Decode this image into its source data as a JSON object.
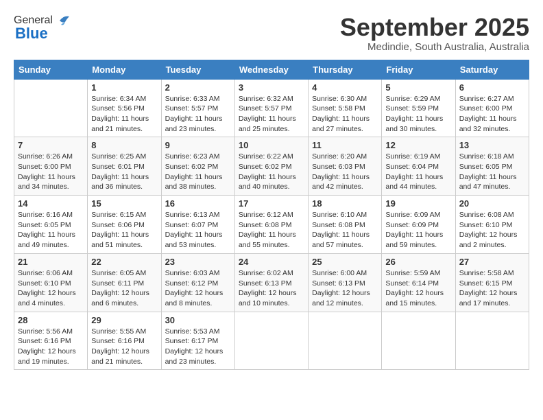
{
  "header": {
    "logo_general": "General",
    "logo_blue": "Blue",
    "month_title": "September 2025",
    "location": "Medindie, South Australia, Australia"
  },
  "calendar": {
    "days_of_week": [
      "Sunday",
      "Monday",
      "Tuesday",
      "Wednesday",
      "Thursday",
      "Friday",
      "Saturday"
    ],
    "weeks": [
      [
        {
          "day": "",
          "text": ""
        },
        {
          "day": "1",
          "text": "Sunrise: 6:34 AM\nSunset: 5:56 PM\nDaylight: 11 hours\nand 21 minutes."
        },
        {
          "day": "2",
          "text": "Sunrise: 6:33 AM\nSunset: 5:57 PM\nDaylight: 11 hours\nand 23 minutes."
        },
        {
          "day": "3",
          "text": "Sunrise: 6:32 AM\nSunset: 5:57 PM\nDaylight: 11 hours\nand 25 minutes."
        },
        {
          "day": "4",
          "text": "Sunrise: 6:30 AM\nSunset: 5:58 PM\nDaylight: 11 hours\nand 27 minutes."
        },
        {
          "day": "5",
          "text": "Sunrise: 6:29 AM\nSunset: 5:59 PM\nDaylight: 11 hours\nand 30 minutes."
        },
        {
          "day": "6",
          "text": "Sunrise: 6:27 AM\nSunset: 6:00 PM\nDaylight: 11 hours\nand 32 minutes."
        }
      ],
      [
        {
          "day": "7",
          "text": "Sunrise: 6:26 AM\nSunset: 6:00 PM\nDaylight: 11 hours\nand 34 minutes."
        },
        {
          "day": "8",
          "text": "Sunrise: 6:25 AM\nSunset: 6:01 PM\nDaylight: 11 hours\nand 36 minutes."
        },
        {
          "day": "9",
          "text": "Sunrise: 6:23 AM\nSunset: 6:02 PM\nDaylight: 11 hours\nand 38 minutes."
        },
        {
          "day": "10",
          "text": "Sunrise: 6:22 AM\nSunset: 6:02 PM\nDaylight: 11 hours\nand 40 minutes."
        },
        {
          "day": "11",
          "text": "Sunrise: 6:20 AM\nSunset: 6:03 PM\nDaylight: 11 hours\nand 42 minutes."
        },
        {
          "day": "12",
          "text": "Sunrise: 6:19 AM\nSunset: 6:04 PM\nDaylight: 11 hours\nand 44 minutes."
        },
        {
          "day": "13",
          "text": "Sunrise: 6:18 AM\nSunset: 6:05 PM\nDaylight: 11 hours\nand 47 minutes."
        }
      ],
      [
        {
          "day": "14",
          "text": "Sunrise: 6:16 AM\nSunset: 6:05 PM\nDaylight: 11 hours\nand 49 minutes."
        },
        {
          "day": "15",
          "text": "Sunrise: 6:15 AM\nSunset: 6:06 PM\nDaylight: 11 hours\nand 51 minutes."
        },
        {
          "day": "16",
          "text": "Sunrise: 6:13 AM\nSunset: 6:07 PM\nDaylight: 11 hours\nand 53 minutes."
        },
        {
          "day": "17",
          "text": "Sunrise: 6:12 AM\nSunset: 6:08 PM\nDaylight: 11 hours\nand 55 minutes."
        },
        {
          "day": "18",
          "text": "Sunrise: 6:10 AM\nSunset: 6:08 PM\nDaylight: 11 hours\nand 57 minutes."
        },
        {
          "day": "19",
          "text": "Sunrise: 6:09 AM\nSunset: 6:09 PM\nDaylight: 11 hours\nand 59 minutes."
        },
        {
          "day": "20",
          "text": "Sunrise: 6:08 AM\nSunset: 6:10 PM\nDaylight: 12 hours\nand 2 minutes."
        }
      ],
      [
        {
          "day": "21",
          "text": "Sunrise: 6:06 AM\nSunset: 6:10 PM\nDaylight: 12 hours\nand 4 minutes."
        },
        {
          "day": "22",
          "text": "Sunrise: 6:05 AM\nSunset: 6:11 PM\nDaylight: 12 hours\nand 6 minutes."
        },
        {
          "day": "23",
          "text": "Sunrise: 6:03 AM\nSunset: 6:12 PM\nDaylight: 12 hours\nand 8 minutes."
        },
        {
          "day": "24",
          "text": "Sunrise: 6:02 AM\nSunset: 6:13 PM\nDaylight: 12 hours\nand 10 minutes."
        },
        {
          "day": "25",
          "text": "Sunrise: 6:00 AM\nSunset: 6:13 PM\nDaylight: 12 hours\nand 12 minutes."
        },
        {
          "day": "26",
          "text": "Sunrise: 5:59 AM\nSunset: 6:14 PM\nDaylight: 12 hours\nand 15 minutes."
        },
        {
          "day": "27",
          "text": "Sunrise: 5:58 AM\nSunset: 6:15 PM\nDaylight: 12 hours\nand 17 minutes."
        }
      ],
      [
        {
          "day": "28",
          "text": "Sunrise: 5:56 AM\nSunset: 6:16 PM\nDaylight: 12 hours\nand 19 minutes."
        },
        {
          "day": "29",
          "text": "Sunrise: 5:55 AM\nSunset: 6:16 PM\nDaylight: 12 hours\nand 21 minutes."
        },
        {
          "day": "30",
          "text": "Sunrise: 5:53 AM\nSunset: 6:17 PM\nDaylight: 12 hours\nand 23 minutes."
        },
        {
          "day": "",
          "text": ""
        },
        {
          "day": "",
          "text": ""
        },
        {
          "day": "",
          "text": ""
        },
        {
          "day": "",
          "text": ""
        }
      ]
    ]
  }
}
